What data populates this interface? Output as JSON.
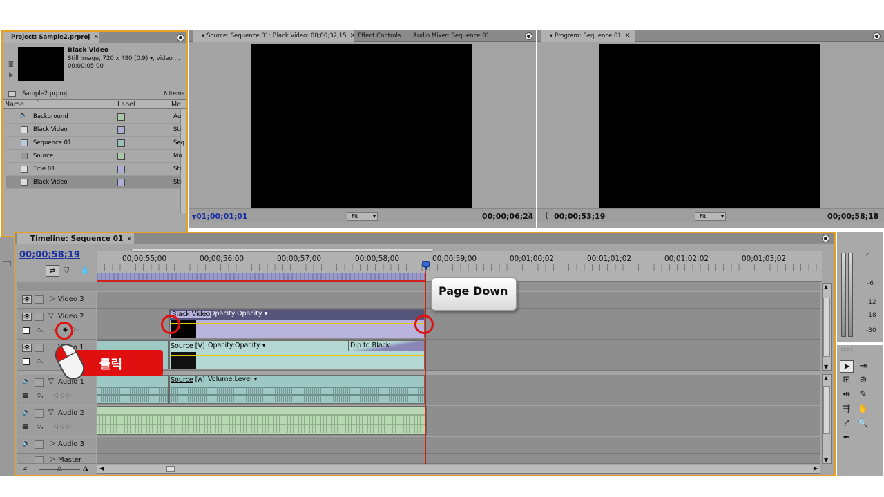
{
  "project": {
    "tab_title": "Project: Sample2.prproj",
    "preview": {
      "name": "Black Video",
      "details": "Still Image, 720 x 480 (0.9)",
      "details_more": ", video ...",
      "duration": "00;00;05;00"
    },
    "file": "Sample2.prproj",
    "count": "6 Items",
    "columns": {
      "name": "Name",
      "label": "Label",
      "media": "Me"
    },
    "items": [
      {
        "name": "Background",
        "icon": "audio-icon",
        "label_color": "#a9c9a9",
        "media": "Au"
      },
      {
        "name": "Black Video",
        "icon": "still-image-icon",
        "label_color": "#b1aed6",
        "media": "Stil"
      },
      {
        "name": "Sequence 01",
        "icon": "sequence-icon",
        "label_color": "#9cbfc0",
        "media": "Seq"
      },
      {
        "name": "Source",
        "icon": "movie-icon",
        "label_color": "#a9c9a9",
        "media": "Mo"
      },
      {
        "name": "Title 01",
        "icon": "title-icon",
        "label_color": "#b1aed6",
        "media": "Stil"
      },
      {
        "name": "Black Video",
        "icon": "still-image-icon",
        "label_color": "#b1aed6",
        "media": "Stil"
      }
    ]
  },
  "source_monitor": {
    "tab_title": "Source: Sequence 01: Black Video: 00;00;32;15",
    "tab2": "Effect Controls",
    "tab3": "Audio Mixer: Sequence 01",
    "timecode_in": "01;00;01;01",
    "fit": "Fit",
    "timecode_out": "00;00;06;24"
  },
  "program_monitor": {
    "tab_title": "Program: Sequence 01",
    "timecode_in": "00;00;53;19",
    "fit": "Fit",
    "timecode_out": "00;00;58;18"
  },
  "timeline": {
    "tab_title": "Timeline: Sequence 01",
    "current_time": "00;00;58;19",
    "ruler": [
      "00;00;55;00",
      "00;00;56;00",
      "00;00;57;00",
      "00;00;58;00",
      "00;00;59;00",
      "00;01;00;02",
      "00;01;01;02",
      "00;01;02;02",
      "00;01;03;02"
    ],
    "tracks": {
      "video3": "Video 3",
      "video2": "Video 2",
      "video1": "Video 1",
      "audio1": "Audio 1",
      "audio2": "Audio 2",
      "audio3": "Audio 3",
      "master": "Master"
    },
    "clips": {
      "black_video": "Black Video",
      "black_video_fx": "Opacity:Opacity",
      "source_v": "Source",
      "source_v_tag": "[V]",
      "source_v_fx": "Opacity:Opacity",
      "transition": "Dip to Black",
      "source_a": "Source",
      "source_a_tag": "[A]",
      "source_a_fx": "Volume:Level"
    }
  },
  "annotations": {
    "key_hint": "Page Down",
    "click_label": "클릭"
  },
  "audio_meter": {
    "labels": [
      "0",
      "-6",
      "-12",
      "-18",
      "-30"
    ]
  },
  "colors": {
    "panel_border": "#e8a020",
    "annotation_red": "#e01010",
    "playhead": "#d02010",
    "timecode_blue": "#1a2fa0"
  }
}
